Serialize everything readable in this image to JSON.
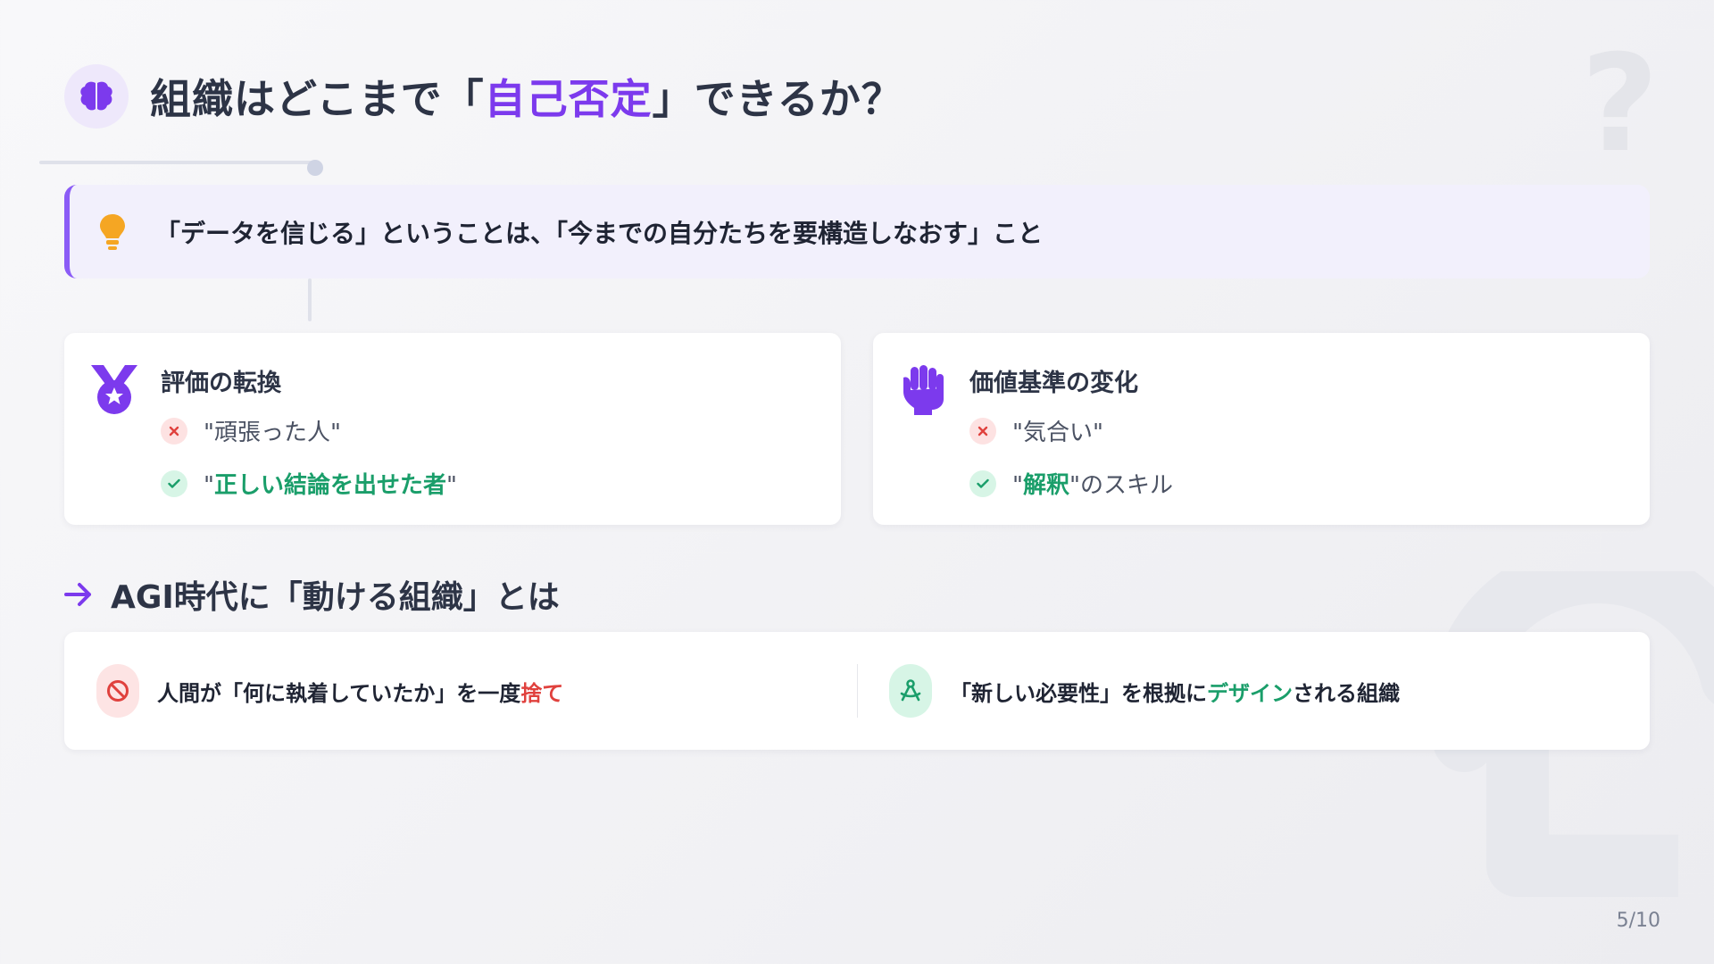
{
  "title": {
    "before": "組織はどこまで「",
    "accent": "自己否定",
    "after": "」できるか？"
  },
  "insight": {
    "text": "「データを信じる」ということは、「今までの自分たちを要構造しなおす」こと"
  },
  "cards": [
    {
      "title": "評価の転換",
      "icon": "medal-icon",
      "negative": "\"頑張った人\"",
      "positive_open": "\"",
      "positive_highlight": "正しい結論を出せた者",
      "positive_close": "\""
    },
    {
      "title": "価値基準の変化",
      "icon": "fist-icon",
      "negative": "\"気合い\"",
      "positive_open": "\"",
      "positive_highlight": "解釈",
      "positive_close": "\"のスキル"
    }
  ],
  "section": {
    "title": "AGI時代に「動ける組織」とは"
  },
  "bottom": {
    "left_text": "人間が「何に執着していたか」を一度",
    "left_highlight": "捨て",
    "right_before": "「新しい必要性」を根拠に",
    "right_highlight": "デザイン",
    "right_after": "される組織"
  },
  "page_number": "5/10",
  "colors": {
    "accent": "#7c3aed",
    "green": "#1a9e6a",
    "red": "#e0413d",
    "text": "#2d3446"
  }
}
